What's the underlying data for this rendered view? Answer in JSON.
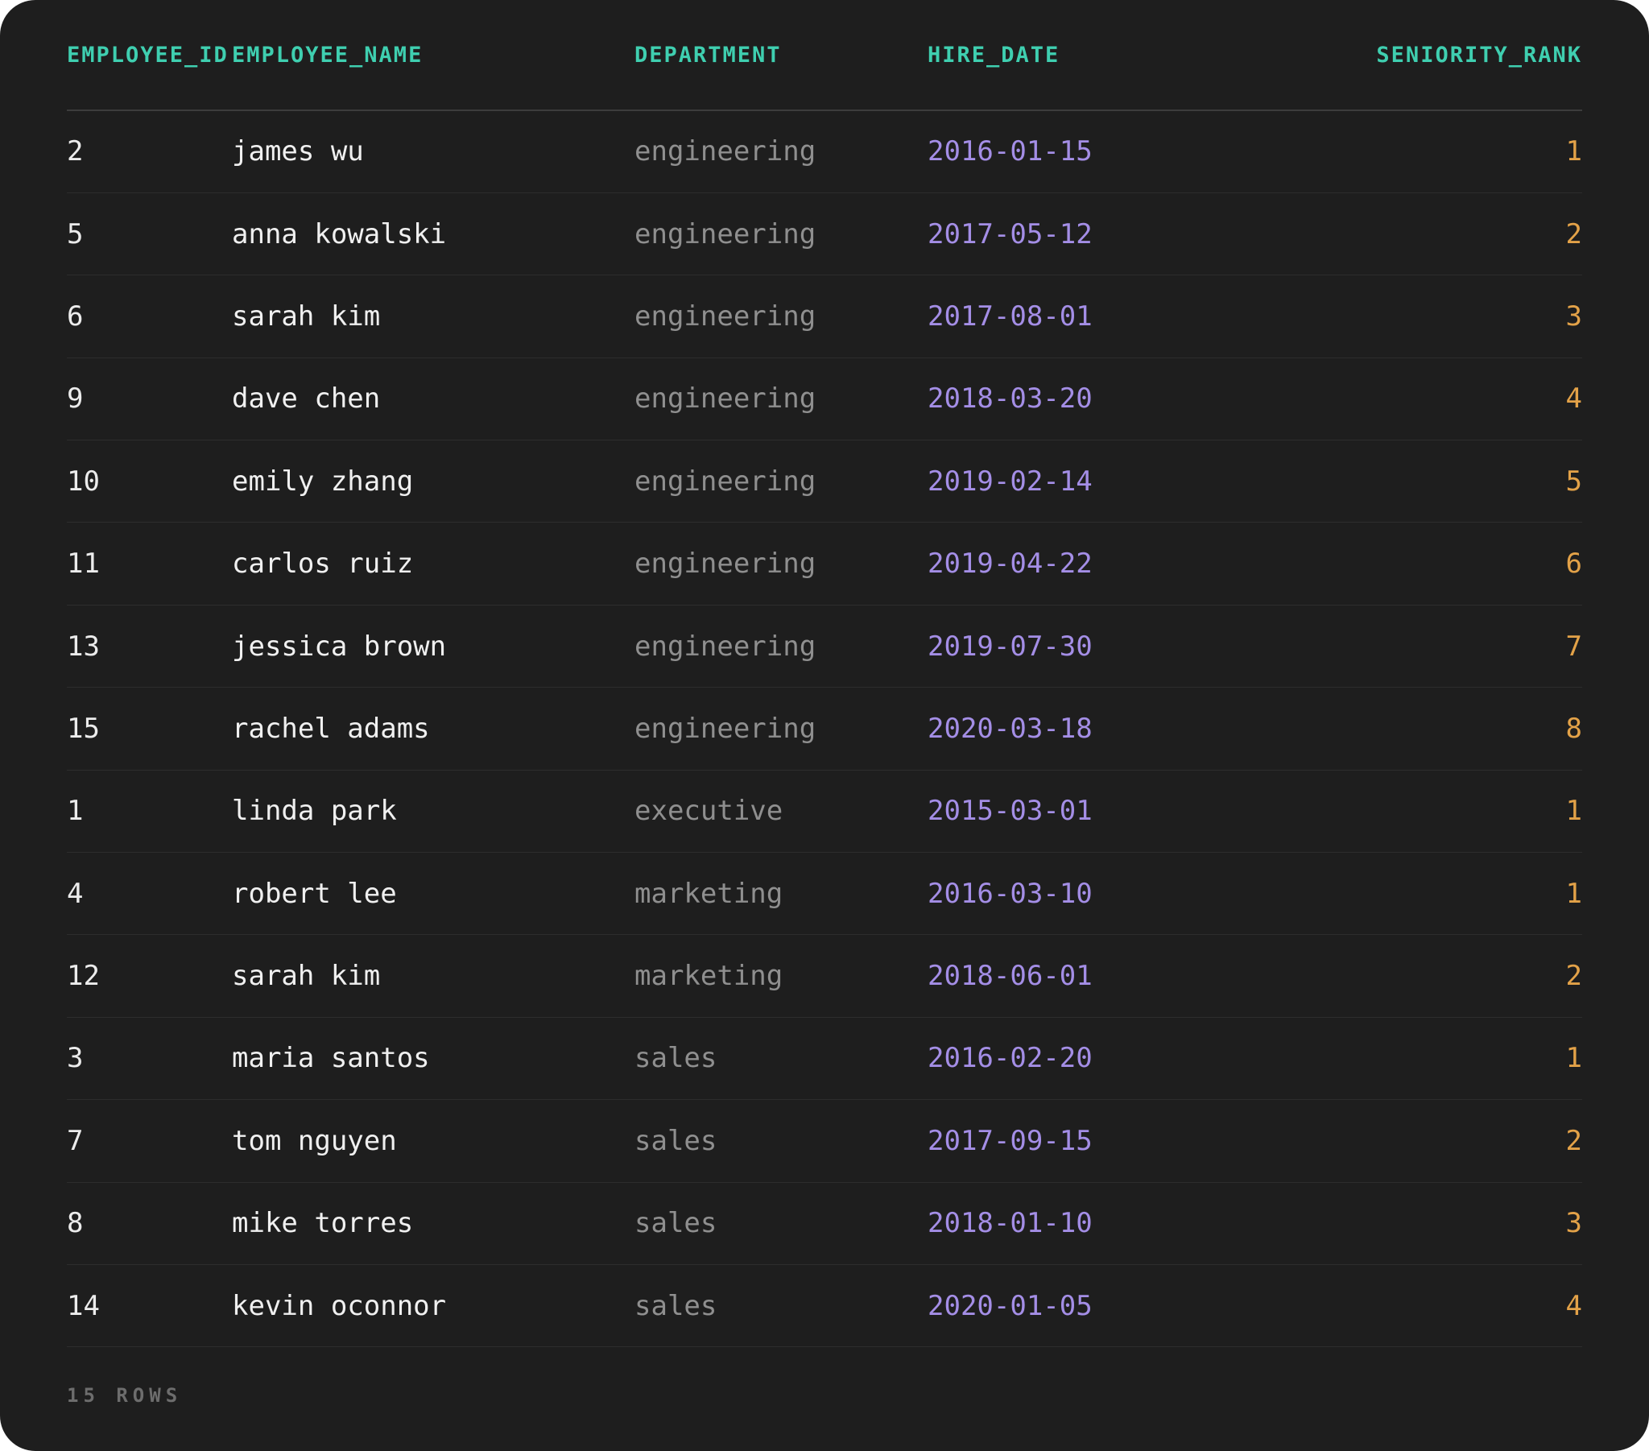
{
  "colors": {
    "background": "#1e1e1e",
    "header_text": "#3fcfb0",
    "id_text": "#ececec",
    "name_text": "#f0f0f0",
    "department_text": "#8f8f8f",
    "date_text": "#a48ee6",
    "rank_text": "#e3a248",
    "footer_text": "#6d6d6d"
  },
  "table": {
    "headers": {
      "employee_id": "EMPLOYEE_ID",
      "employee_name": "EMPLOYEE_NAME",
      "department": "DEPARTMENT",
      "hire_date": "HIRE_DATE",
      "seniority_rank": "SENIORITY_RANK"
    },
    "rows": [
      {
        "employee_id": "2",
        "employee_name": "james wu",
        "department": "engineering",
        "hire_date": "2016-01-15",
        "seniority_rank": "1"
      },
      {
        "employee_id": "5",
        "employee_name": "anna kowalski",
        "department": "engineering",
        "hire_date": "2017-05-12",
        "seniority_rank": "2"
      },
      {
        "employee_id": "6",
        "employee_name": "sarah kim",
        "department": "engineering",
        "hire_date": "2017-08-01",
        "seniority_rank": "3"
      },
      {
        "employee_id": "9",
        "employee_name": "dave chen",
        "department": "engineering",
        "hire_date": "2018-03-20",
        "seniority_rank": "4"
      },
      {
        "employee_id": "10",
        "employee_name": "emily zhang",
        "department": "engineering",
        "hire_date": "2019-02-14",
        "seniority_rank": "5"
      },
      {
        "employee_id": "11",
        "employee_name": "carlos ruiz",
        "department": "engineering",
        "hire_date": "2019-04-22",
        "seniority_rank": "6"
      },
      {
        "employee_id": "13",
        "employee_name": "jessica brown",
        "department": "engineering",
        "hire_date": "2019-07-30",
        "seniority_rank": "7"
      },
      {
        "employee_id": "15",
        "employee_name": "rachel adams",
        "department": "engineering",
        "hire_date": "2020-03-18",
        "seniority_rank": "8"
      },
      {
        "employee_id": "1",
        "employee_name": "linda park",
        "department": "executive",
        "hire_date": "2015-03-01",
        "seniority_rank": "1"
      },
      {
        "employee_id": "4",
        "employee_name": "robert lee",
        "department": "marketing",
        "hire_date": "2016-03-10",
        "seniority_rank": "1"
      },
      {
        "employee_id": "12",
        "employee_name": "sarah kim",
        "department": "marketing",
        "hire_date": "2018-06-01",
        "seniority_rank": "2"
      },
      {
        "employee_id": "3",
        "employee_name": "maria santos",
        "department": "sales",
        "hire_date": "2016-02-20",
        "seniority_rank": "1"
      },
      {
        "employee_id": "7",
        "employee_name": "tom nguyen",
        "department": "sales",
        "hire_date": "2017-09-15",
        "seniority_rank": "2"
      },
      {
        "employee_id": "8",
        "employee_name": "mike torres",
        "department": "sales",
        "hire_date": "2018-01-10",
        "seniority_rank": "3"
      },
      {
        "employee_id": "14",
        "employee_name": "kevin oconnor",
        "department": "sales",
        "hire_date": "2020-01-05",
        "seniority_rank": "4"
      }
    ]
  },
  "footer": {
    "row_count_label": "15 ROWS"
  }
}
